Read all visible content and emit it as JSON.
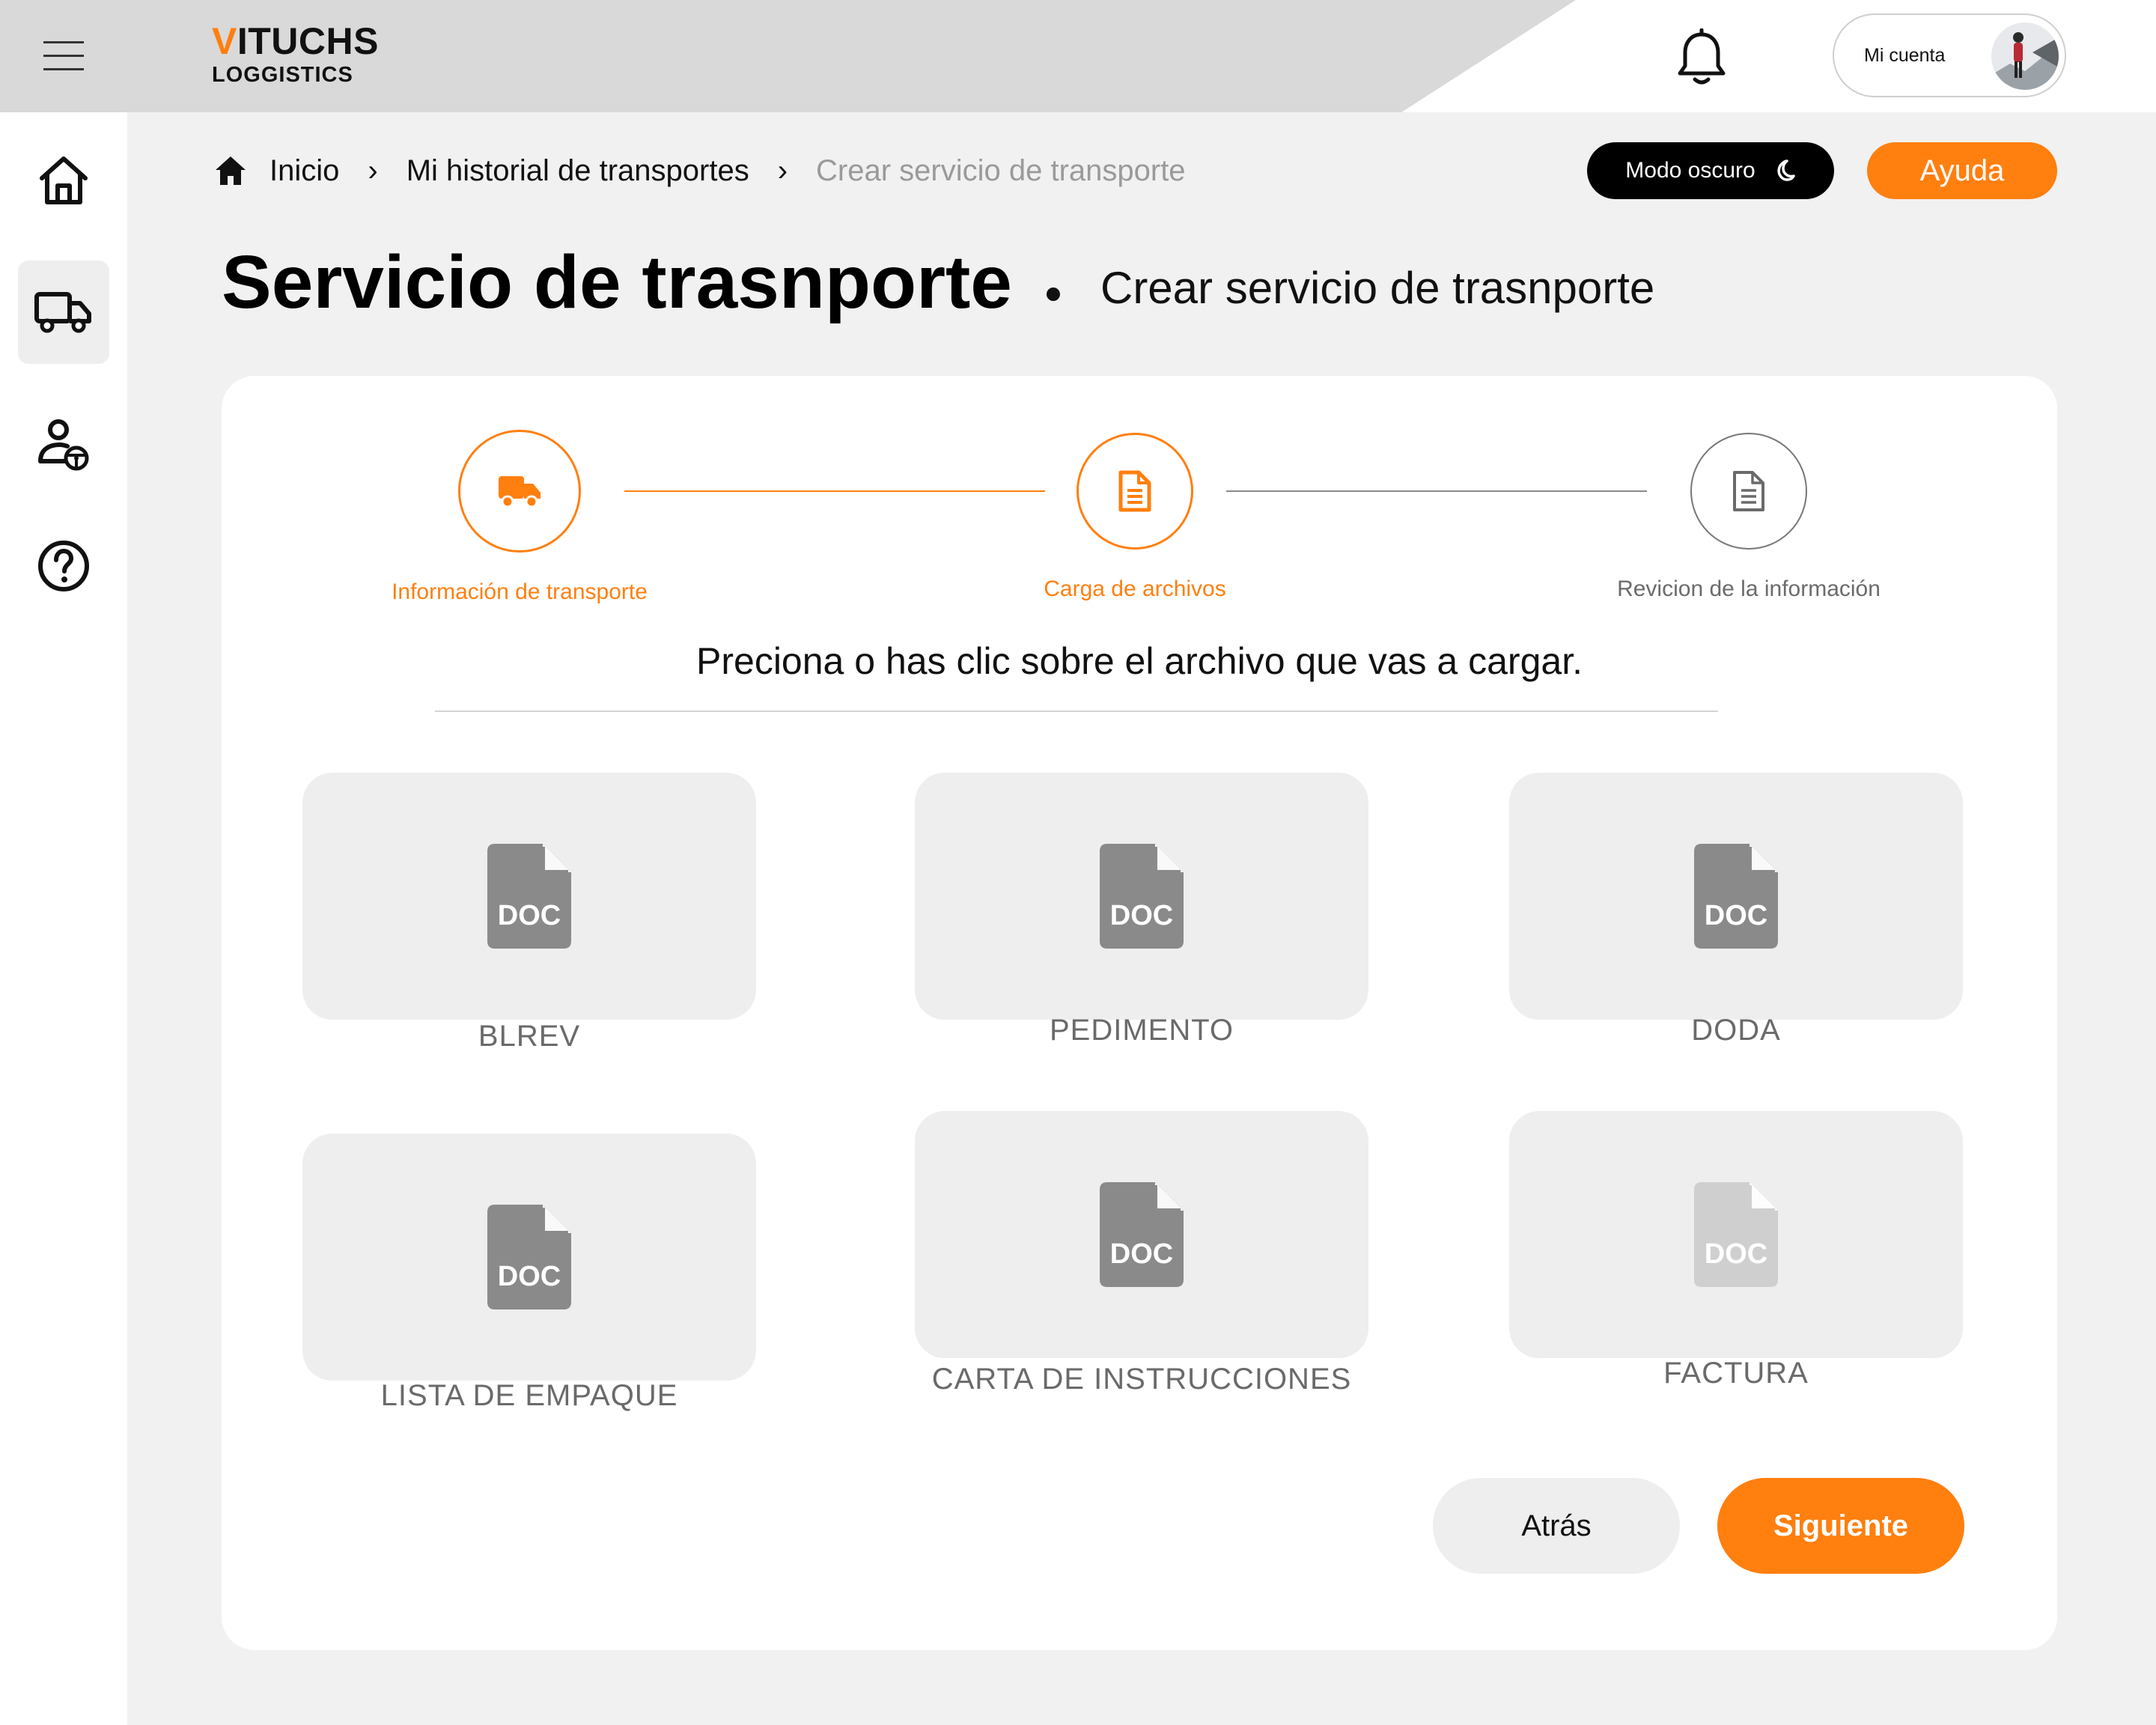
{
  "header": {
    "logo_accent": "V",
    "logo_rest": "ITUCHS",
    "logo_sub": "LOGGISTICS",
    "account_label": "Mi cuenta",
    "icons": {
      "menu": "hamburger-icon",
      "notifications": "bell-icon",
      "avatar": "user-avatar"
    }
  },
  "sidebar": {
    "items": [
      {
        "name": "home",
        "icon": "home-icon",
        "active": false
      },
      {
        "name": "transports",
        "icon": "truck-icon",
        "active": true
      },
      {
        "name": "drivers",
        "icon": "driver-user-icon",
        "active": false
      },
      {
        "name": "help",
        "icon": "question-icon",
        "active": false
      }
    ]
  },
  "breadcrumb": {
    "items": [
      "Inicio",
      "Mi historial de transportes",
      "Crear servicio de transporte"
    ],
    "separator": "›"
  },
  "actions": {
    "dark_mode_label": "Modo oscuro",
    "help_label": "Ayuda"
  },
  "page": {
    "title": "Servicio de trasnporte",
    "subtitle": "Crear servicio de trasnporte"
  },
  "stepper": {
    "steps": [
      {
        "label": "Información de transporte",
        "icon": "truck-icon",
        "status": "complete"
      },
      {
        "label": "Carga de archivos",
        "icon": "document-icon",
        "status": "current"
      },
      {
        "label": "Revicion de la información",
        "icon": "document-icon",
        "status": "pending"
      }
    ]
  },
  "instruction": "Preciona o has clic sobre el archivo que vas a cargar.",
  "documents": [
    {
      "label": "BLREV",
      "icon_text": "DOC",
      "enabled": true
    },
    {
      "label": "PEDIMENTO",
      "icon_text": "DOC",
      "enabled": true
    },
    {
      "label": "DODA",
      "icon_text": "DOC",
      "enabled": true
    },
    {
      "label": "LISTA DE EMPAQUE",
      "icon_text": "DOC",
      "enabled": true
    },
    {
      "label": "CARTA DE INSTRUCCIONES",
      "icon_text": "DOC",
      "enabled": true
    },
    {
      "label": "FACTURA",
      "icon_text": "DOC",
      "enabled": false
    }
  ],
  "buttons": {
    "back": "Atrás",
    "next": "Siguiente"
  },
  "colors": {
    "accent": "#ff7f0f",
    "doc_icon": "#8a8a8a",
    "doc_icon_disabled": "#cfcfcf"
  }
}
